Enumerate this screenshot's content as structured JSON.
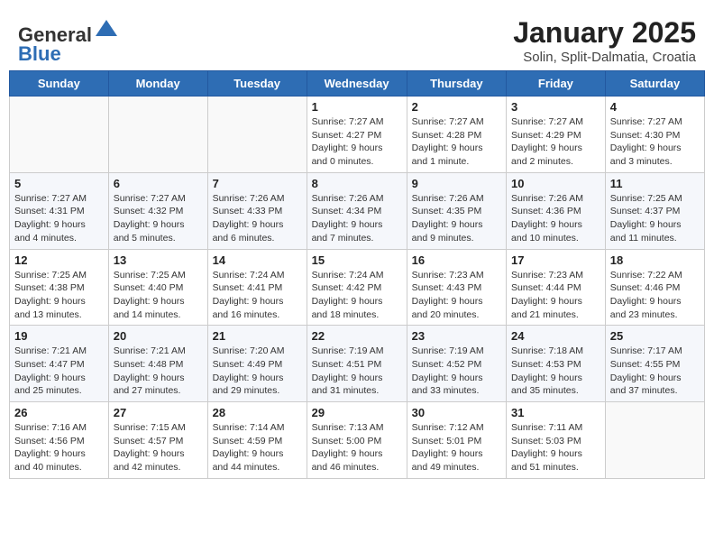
{
  "header": {
    "logo_general": "General",
    "logo_blue": "Blue",
    "title": "January 2025",
    "location": "Solin, Split-Dalmatia, Croatia"
  },
  "weekdays": [
    "Sunday",
    "Monday",
    "Tuesday",
    "Wednesday",
    "Thursday",
    "Friday",
    "Saturday"
  ],
  "weeks": [
    [
      {
        "day": "",
        "info": ""
      },
      {
        "day": "",
        "info": ""
      },
      {
        "day": "",
        "info": ""
      },
      {
        "day": "1",
        "info": "Sunrise: 7:27 AM\nSunset: 4:27 PM\nDaylight: 9 hours\nand 0 minutes."
      },
      {
        "day": "2",
        "info": "Sunrise: 7:27 AM\nSunset: 4:28 PM\nDaylight: 9 hours\nand 1 minute."
      },
      {
        "day": "3",
        "info": "Sunrise: 7:27 AM\nSunset: 4:29 PM\nDaylight: 9 hours\nand 2 minutes."
      },
      {
        "day": "4",
        "info": "Sunrise: 7:27 AM\nSunset: 4:30 PM\nDaylight: 9 hours\nand 3 minutes."
      }
    ],
    [
      {
        "day": "5",
        "info": "Sunrise: 7:27 AM\nSunset: 4:31 PM\nDaylight: 9 hours\nand 4 minutes."
      },
      {
        "day": "6",
        "info": "Sunrise: 7:27 AM\nSunset: 4:32 PM\nDaylight: 9 hours\nand 5 minutes."
      },
      {
        "day": "7",
        "info": "Sunrise: 7:26 AM\nSunset: 4:33 PM\nDaylight: 9 hours\nand 6 minutes."
      },
      {
        "day": "8",
        "info": "Sunrise: 7:26 AM\nSunset: 4:34 PM\nDaylight: 9 hours\nand 7 minutes."
      },
      {
        "day": "9",
        "info": "Sunrise: 7:26 AM\nSunset: 4:35 PM\nDaylight: 9 hours\nand 9 minutes."
      },
      {
        "day": "10",
        "info": "Sunrise: 7:26 AM\nSunset: 4:36 PM\nDaylight: 9 hours\nand 10 minutes."
      },
      {
        "day": "11",
        "info": "Sunrise: 7:25 AM\nSunset: 4:37 PM\nDaylight: 9 hours\nand 11 minutes."
      }
    ],
    [
      {
        "day": "12",
        "info": "Sunrise: 7:25 AM\nSunset: 4:38 PM\nDaylight: 9 hours\nand 13 minutes."
      },
      {
        "day": "13",
        "info": "Sunrise: 7:25 AM\nSunset: 4:40 PM\nDaylight: 9 hours\nand 14 minutes."
      },
      {
        "day": "14",
        "info": "Sunrise: 7:24 AM\nSunset: 4:41 PM\nDaylight: 9 hours\nand 16 minutes."
      },
      {
        "day": "15",
        "info": "Sunrise: 7:24 AM\nSunset: 4:42 PM\nDaylight: 9 hours\nand 18 minutes."
      },
      {
        "day": "16",
        "info": "Sunrise: 7:23 AM\nSunset: 4:43 PM\nDaylight: 9 hours\nand 20 minutes."
      },
      {
        "day": "17",
        "info": "Sunrise: 7:23 AM\nSunset: 4:44 PM\nDaylight: 9 hours\nand 21 minutes."
      },
      {
        "day": "18",
        "info": "Sunrise: 7:22 AM\nSunset: 4:46 PM\nDaylight: 9 hours\nand 23 minutes."
      }
    ],
    [
      {
        "day": "19",
        "info": "Sunrise: 7:21 AM\nSunset: 4:47 PM\nDaylight: 9 hours\nand 25 minutes."
      },
      {
        "day": "20",
        "info": "Sunrise: 7:21 AM\nSunset: 4:48 PM\nDaylight: 9 hours\nand 27 minutes."
      },
      {
        "day": "21",
        "info": "Sunrise: 7:20 AM\nSunset: 4:49 PM\nDaylight: 9 hours\nand 29 minutes."
      },
      {
        "day": "22",
        "info": "Sunrise: 7:19 AM\nSunset: 4:51 PM\nDaylight: 9 hours\nand 31 minutes."
      },
      {
        "day": "23",
        "info": "Sunrise: 7:19 AM\nSunset: 4:52 PM\nDaylight: 9 hours\nand 33 minutes."
      },
      {
        "day": "24",
        "info": "Sunrise: 7:18 AM\nSunset: 4:53 PM\nDaylight: 9 hours\nand 35 minutes."
      },
      {
        "day": "25",
        "info": "Sunrise: 7:17 AM\nSunset: 4:55 PM\nDaylight: 9 hours\nand 37 minutes."
      }
    ],
    [
      {
        "day": "26",
        "info": "Sunrise: 7:16 AM\nSunset: 4:56 PM\nDaylight: 9 hours\nand 40 minutes."
      },
      {
        "day": "27",
        "info": "Sunrise: 7:15 AM\nSunset: 4:57 PM\nDaylight: 9 hours\nand 42 minutes."
      },
      {
        "day": "28",
        "info": "Sunrise: 7:14 AM\nSunset: 4:59 PM\nDaylight: 9 hours\nand 44 minutes."
      },
      {
        "day": "29",
        "info": "Sunrise: 7:13 AM\nSunset: 5:00 PM\nDaylight: 9 hours\nand 46 minutes."
      },
      {
        "day": "30",
        "info": "Sunrise: 7:12 AM\nSunset: 5:01 PM\nDaylight: 9 hours\nand 49 minutes."
      },
      {
        "day": "31",
        "info": "Sunrise: 7:11 AM\nSunset: 5:03 PM\nDaylight: 9 hours\nand 51 minutes."
      },
      {
        "day": "",
        "info": ""
      }
    ]
  ]
}
